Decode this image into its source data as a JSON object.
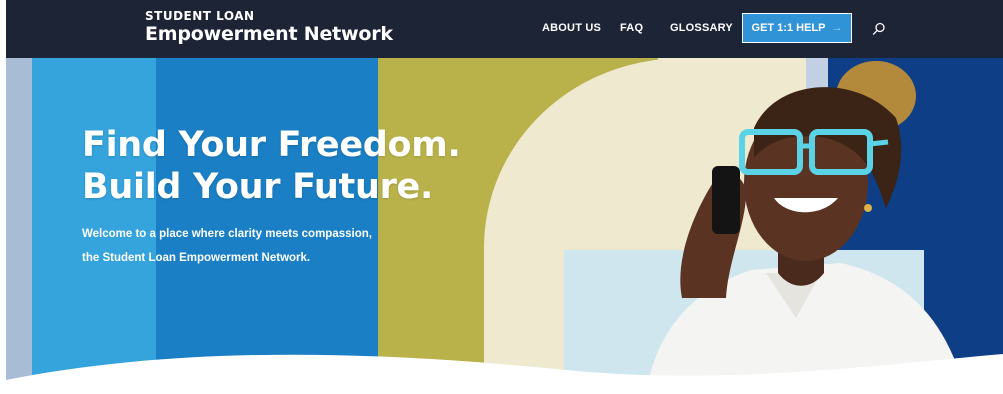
{
  "header": {
    "logo_top": "STUDENT LOAN",
    "logo_main": "Empowerment Network",
    "nav": {
      "about": "ABOUT US",
      "faq": "FAQ",
      "glossary": "GLOSSARY"
    },
    "cta": {
      "label": "GET 1:1 HELP",
      "arrow": "→"
    },
    "search_icon": "search-icon"
  },
  "hero": {
    "title_line1": "Find Your Freedom.",
    "title_line2": "Build Your Future.",
    "subtitle_line1": "Welcome to a place where clarity meets compassion,",
    "subtitle_line2": "the Student Loan Empowerment Network.",
    "image": "woman-on-phone-with-blue-glasses"
  },
  "colors": {
    "header_bg": "#1d2436",
    "cta_bg": "#2f93d6",
    "hero_blue": "#1a7fc4",
    "hero_light_blue": "#35a3dc",
    "hero_olive": "#b9b24a",
    "hero_cream": "#efe9cf",
    "hero_navy": "#0e3f86"
  }
}
